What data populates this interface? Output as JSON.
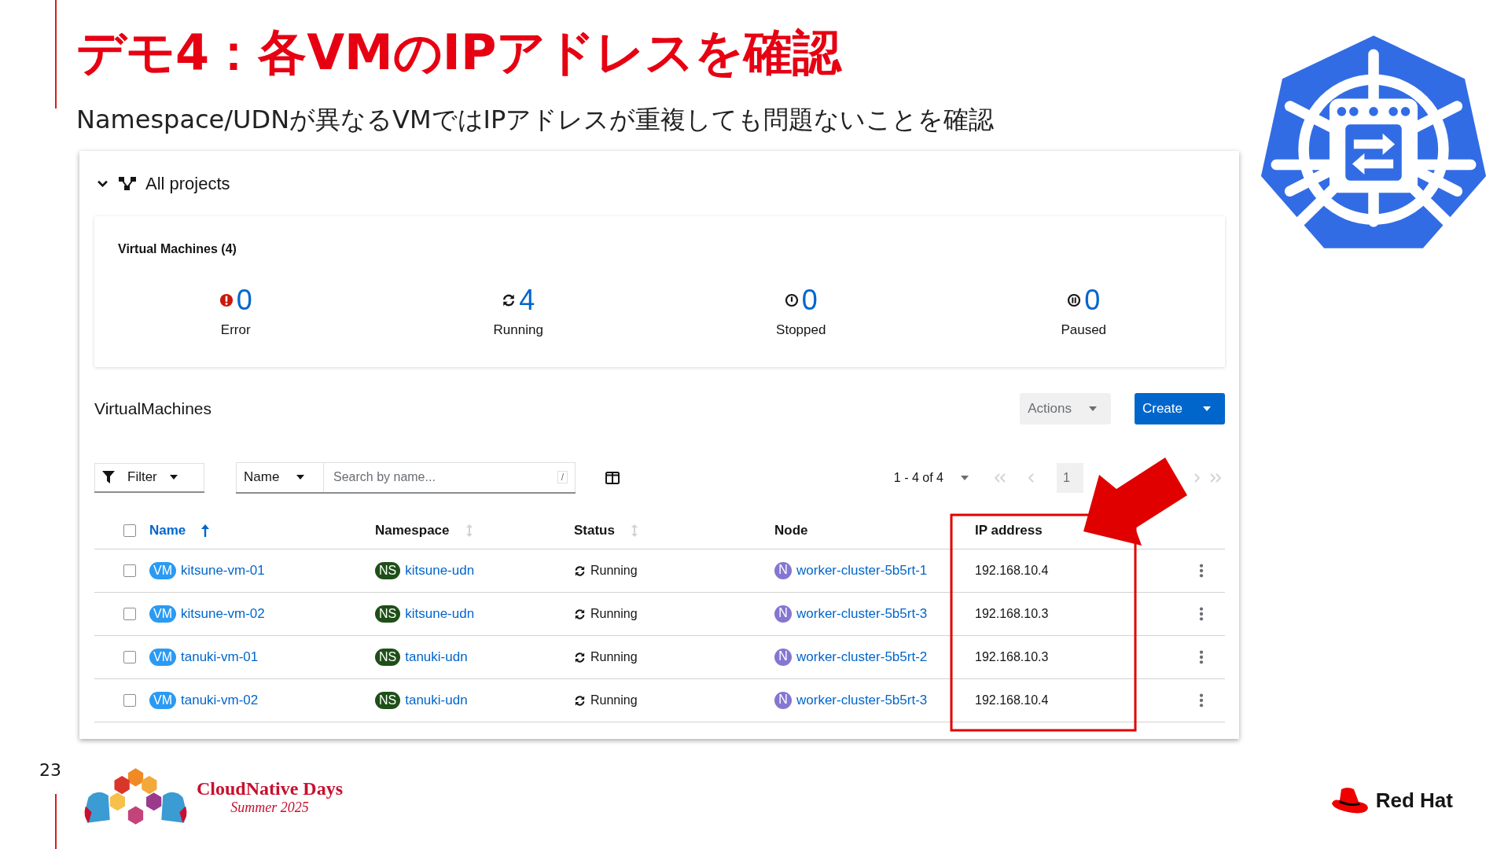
{
  "slide": {
    "title": "デモ4：各VMのIPアドレスを確認",
    "subtitle": "Namespace/UDNが異なるVMではIPアドレスが重複しても問題ないことを確認",
    "page_number": "23"
  },
  "project_selector": {
    "label": "All projects",
    "expanded": true
  },
  "summary": {
    "title": "Virtual Machines (4)",
    "counts": [
      {
        "kind": "error",
        "count": "0",
        "label": "Error"
      },
      {
        "kind": "running",
        "count": "4",
        "label": "Running"
      },
      {
        "kind": "stopped",
        "count": "0",
        "label": "Stopped"
      },
      {
        "kind": "paused",
        "count": "0",
        "label": "Paused"
      }
    ]
  },
  "list": {
    "title": "VirtualMachines",
    "actions": "Actions",
    "create": "Create",
    "filter": "Filter",
    "search_by": "Name",
    "search": {
      "placeholder": "Search by name...",
      "shortcut": "/"
    },
    "pagination": {
      "range": "1 - 4 of 4",
      "page": "1"
    }
  },
  "table": {
    "select_all": {
      "checked": false
    },
    "columns": [
      {
        "label": "Name",
        "sortable": true,
        "sorted": true
      },
      {
        "label": "Namespace",
        "sortable": true,
        "sorted": false
      },
      {
        "label": "Status",
        "sortable": true,
        "sorted": false
      },
      {
        "label": "Node"
      },
      {
        "label": "IP address"
      }
    ],
    "rows": [
      {
        "checked": false,
        "vm_badge": "VM",
        "name": "kitsune-vm-01",
        "ns_badge": "NS",
        "namespace": "kitsune-udn",
        "status": "Running",
        "node_badge": "N",
        "node": "worker-cluster-5b5rt-1",
        "ip": "192.168.10.4"
      },
      {
        "checked": false,
        "vm_badge": "VM",
        "name": "kitsune-vm-02",
        "ns_badge": "NS",
        "namespace": "kitsune-udn",
        "status": "Running",
        "node_badge": "N",
        "node": "worker-cluster-5b5rt-3",
        "ip": "192.168.10.3"
      },
      {
        "checked": false,
        "vm_badge": "VM",
        "name": "tanuki-vm-01",
        "ns_badge": "NS",
        "namespace": "tanuki-udn",
        "status": "Running",
        "node_badge": "N",
        "node": "worker-cluster-5b5rt-2",
        "ip": "192.168.10.3"
      },
      {
        "checked": false,
        "vm_badge": "VM",
        "name": "tanuki-vm-02",
        "ns_badge": "NS",
        "namespace": "tanuki-udn",
        "status": "Running",
        "node_badge": "N",
        "node": "worker-cluster-5b5rt-3",
        "ip": "192.168.10.4"
      }
    ]
  },
  "footer": {
    "event_name": "CloudNative Days",
    "event_edition": "Summer 2025",
    "company": "Red Hat"
  }
}
